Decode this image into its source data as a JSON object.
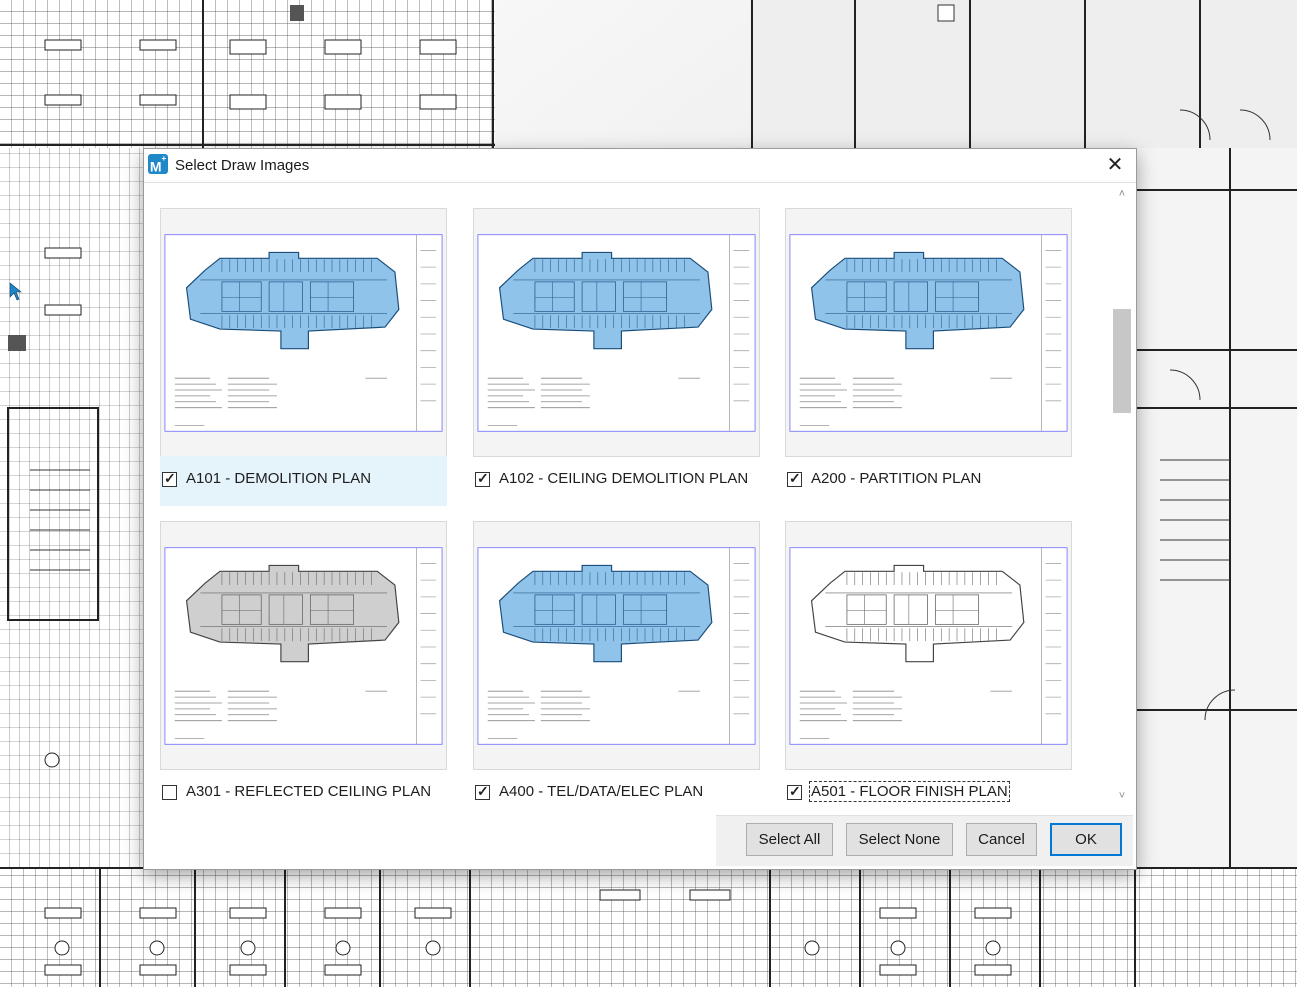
{
  "dialog": {
    "title": "Select Draw Images",
    "app_icon_text": "M",
    "close_label": "✕",
    "items": [
      {
        "label": "A101 - DEMOLITION PLAN",
        "checked": true,
        "style": "blue",
        "selected": true,
        "focused": false
      },
      {
        "label": "A102 - CEILING DEMOLITION PLAN",
        "checked": true,
        "style": "blue",
        "selected": false,
        "focused": false
      },
      {
        "label": "A200 - PARTITION PLAN",
        "checked": true,
        "style": "blue",
        "selected": false,
        "focused": false
      },
      {
        "label": "A301 - REFLECTED CEILING PLAN",
        "checked": false,
        "style": "gray",
        "selected": false,
        "focused": false
      },
      {
        "label": "A400 - TEL/DATA/ELEC PLAN",
        "checked": true,
        "style": "blue",
        "selected": false,
        "focused": false
      },
      {
        "label": "A501 - FLOOR FINISH PLAN",
        "checked": true,
        "style": "outline",
        "selected": false,
        "focused": true
      }
    ],
    "buttons": {
      "select_all": "Select All",
      "select_none": "Select None",
      "cancel": "Cancel",
      "ok": "OK"
    }
  },
  "colors": {
    "plan_blue": "#8fc3ea",
    "plan_blue_dark": "#1b4e7a",
    "plan_gray": "#cfcfcf",
    "accent": "#0078d7"
  },
  "icons": {
    "app": "m-logo-icon",
    "close": "close-icon",
    "checkbox": "checkmark-icon",
    "scroll_up": "chevron-up-icon",
    "scroll_down": "chevron-down-icon"
  }
}
